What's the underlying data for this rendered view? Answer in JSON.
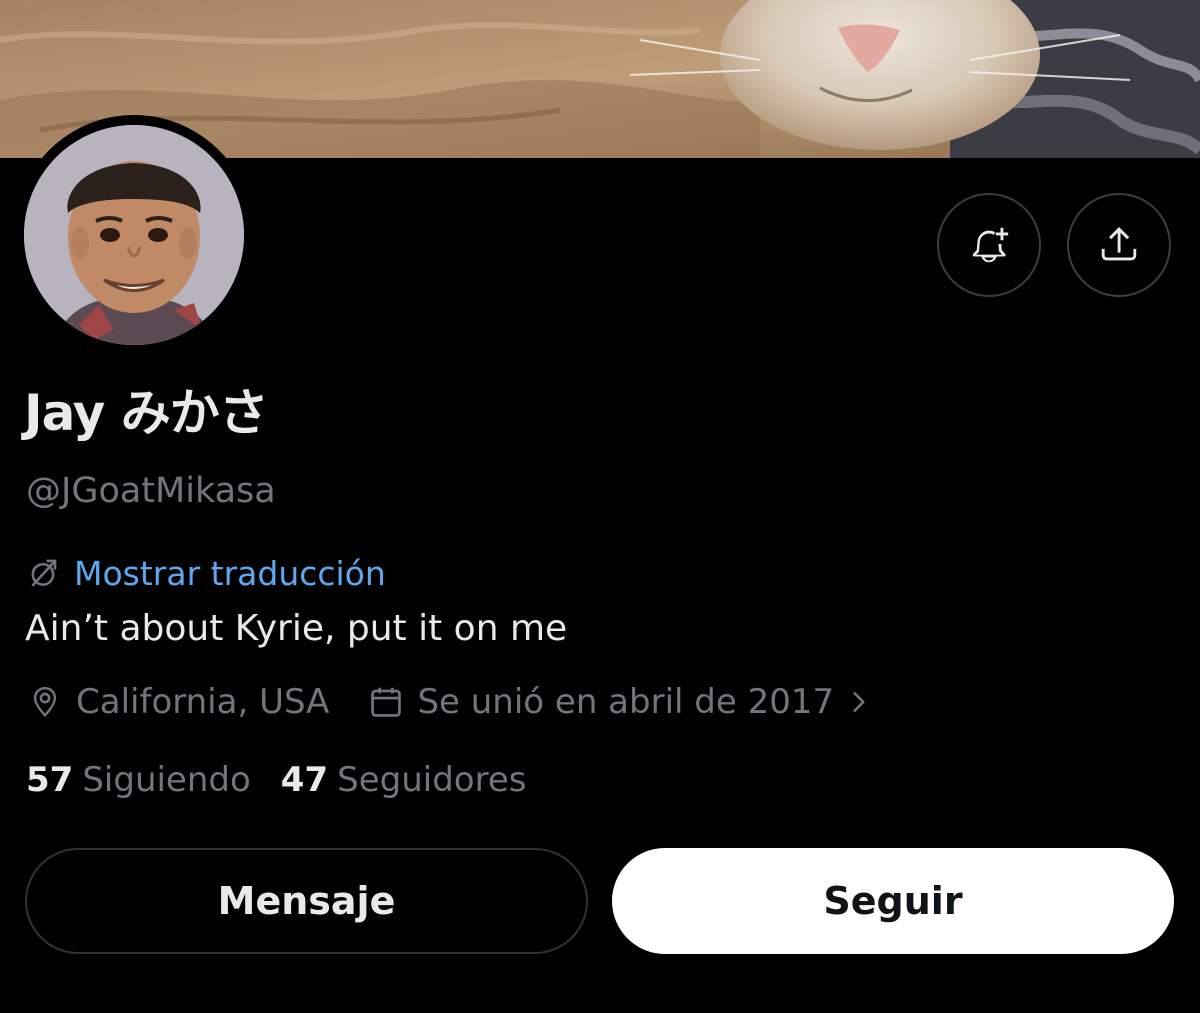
{
  "profile": {
    "display_name": "Jay みかさ",
    "handle": "@JGoatMikasa",
    "translate_label": "Mostrar traducción",
    "bio": "Ain’t about Kyrie, put it on me",
    "location": "California, USA",
    "joined": "Se unió en abril de 2017"
  },
  "stats": {
    "following_count": "57",
    "following_label": "Siguiendo",
    "followers_count": "47",
    "followers_label": "Seguidores"
  },
  "actions": {
    "message_label": "Mensaje",
    "follow_label": "Seguir",
    "notify_icon": "bell-plus-icon",
    "share_icon": "share-upload-icon"
  },
  "colors": {
    "background": "#000000",
    "text_primary": "#e7e9ea",
    "text_secondary": "#71767b",
    "link": "#5ea8ef",
    "follow_button": "#ffffff"
  }
}
